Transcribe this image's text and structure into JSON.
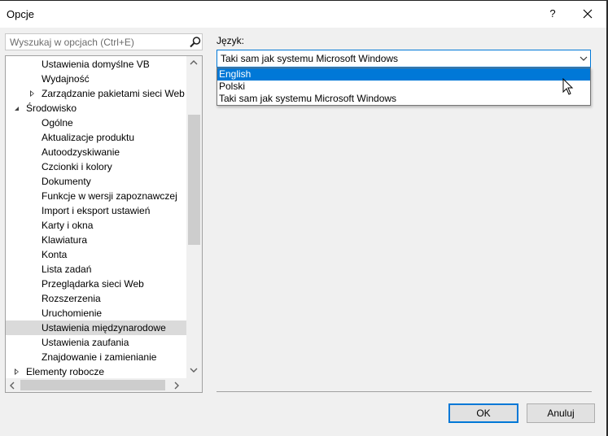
{
  "window": {
    "title": "Opcje",
    "help_label": "?"
  },
  "search": {
    "placeholder": "Wyszukaj w opcjach (Ctrl+E)"
  },
  "tree": {
    "items": [
      {
        "label": "Ustawienia domyślne VB",
        "level": 2,
        "expander": "none"
      },
      {
        "label": "Wydajność",
        "level": 2,
        "expander": "none"
      },
      {
        "label": "Zarządzanie pakietami sieci Web",
        "level": 2,
        "expander": "collapsed"
      },
      {
        "label": "Środowisko",
        "level": 1,
        "expander": "expanded"
      },
      {
        "label": "Ogólne",
        "level": 2,
        "expander": "none"
      },
      {
        "label": "Aktualizacje produktu",
        "level": 2,
        "expander": "none"
      },
      {
        "label": "Autoodzyskiwanie",
        "level": 2,
        "expander": "none"
      },
      {
        "label": "Czcionki i kolory",
        "level": 2,
        "expander": "none"
      },
      {
        "label": "Dokumenty",
        "level": 2,
        "expander": "none"
      },
      {
        "label": "Funkcje w wersji zapoznawczej",
        "level": 2,
        "expander": "none"
      },
      {
        "label": "Import i eksport ustawień",
        "level": 2,
        "expander": "none"
      },
      {
        "label": "Karty i okna",
        "level": 2,
        "expander": "none"
      },
      {
        "label": "Klawiatura",
        "level": 2,
        "expander": "none"
      },
      {
        "label": "Konta",
        "level": 2,
        "expander": "none"
      },
      {
        "label": "Lista zadań",
        "level": 2,
        "expander": "none"
      },
      {
        "label": "Przeglądarka sieci Web",
        "level": 2,
        "expander": "none"
      },
      {
        "label": "Rozszerzenia",
        "level": 2,
        "expander": "none"
      },
      {
        "label": "Uruchomienie",
        "level": 2,
        "expander": "none"
      },
      {
        "label": "Ustawienia międzynarodowe",
        "level": 2,
        "expander": "none",
        "selected": true
      },
      {
        "label": "Ustawienia zaufania",
        "level": 2,
        "expander": "none"
      },
      {
        "label": "Znajdowanie i zamienianie",
        "level": 2,
        "expander": "none"
      },
      {
        "label": "Elementy robocze",
        "level": 1,
        "expander": "collapsed"
      }
    ]
  },
  "language": {
    "label": "Język:",
    "selected": "Taki sam jak systemu Microsoft Windows",
    "options": [
      "English",
      "Polski",
      "Taki sam jak systemu Microsoft Windows"
    ],
    "highlighted_index": 0
  },
  "buttons": {
    "ok": "OK",
    "cancel": "Anuluj"
  },
  "colors": {
    "accent": "#0078d7",
    "selection": "#dadada"
  }
}
